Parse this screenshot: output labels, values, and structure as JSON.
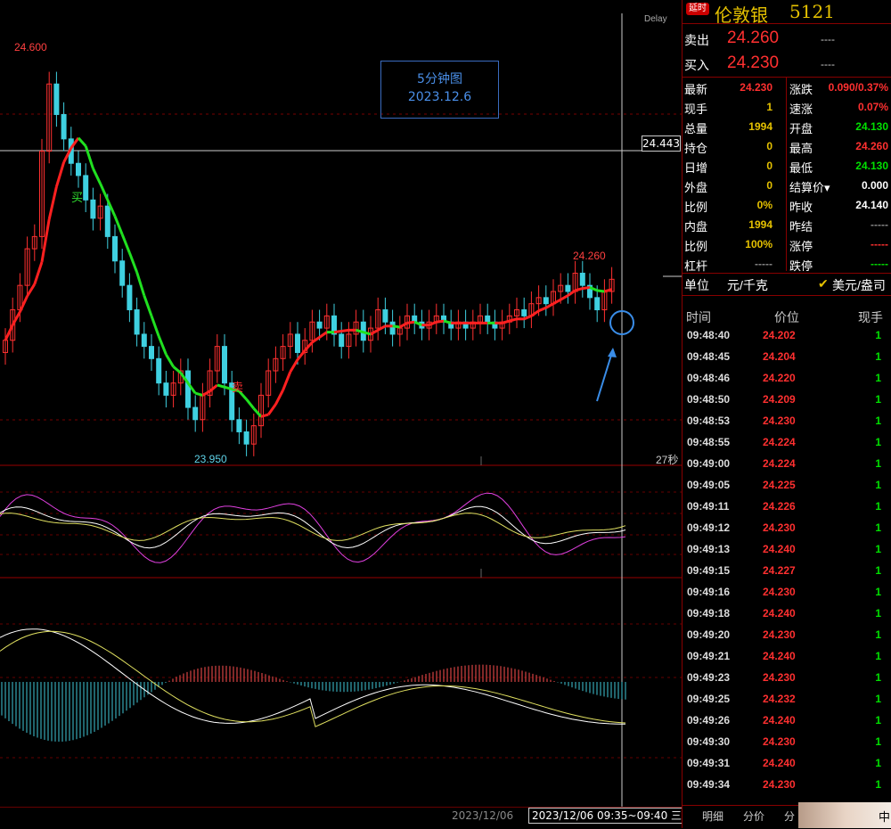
{
  "chart": {
    "delay_label": "Delay",
    "high_label": "24.600",
    "low_label": "23.950",
    "recent_high_label": "24.260",
    "crosshair_price": "24.443",
    "countdown": "27秒",
    "buy_marker": "买",
    "sell_marker": "卖",
    "annotation_line1": "5分钟图",
    "annotation_line2": "2023.12.6",
    "date_left": "2023/12/06",
    "date_range": "2023/12/06 09:35~09:40 三"
  },
  "chart_data": {
    "type": "candlestick",
    "price_range": [
      23.95,
      24.6
    ],
    "closes": [
      24.13,
      24.18,
      24.22,
      24.28,
      24.3,
      24.44,
      24.55,
      24.5,
      24.46,
      24.42,
      24.4,
      24.36,
      24.33,
      24.35,
      24.3,
      24.26,
      24.22,
      24.18,
      24.14,
      24.12,
      24.1,
      24.06,
      24.04,
      24.06,
      24.08,
      24.02,
      24.0,
      24.04,
      24.08,
      24.12,
      24.06,
      24.0,
      23.98,
      23.96,
      23.99,
      24.04,
      24.08,
      24.1,
      24.12,
      24.14,
      24.11,
      24.13,
      24.16,
      24.15,
      24.17,
      24.14,
      24.12,
      24.14,
      24.16,
      24.13,
      24.15,
      24.18,
      24.16,
      24.14,
      24.15,
      24.17,
      24.16,
      24.15,
      24.16,
      24.17,
      24.16,
      24.15,
      24.16,
      24.15,
      24.16,
      24.17,
      24.16,
      24.15,
      24.16,
      24.17,
      24.18,
      24.17,
      24.19,
      24.2,
      24.19,
      24.21,
      24.22,
      24.21,
      24.24,
      24.22,
      24.2,
      24.18,
      24.21,
      24.23
    ]
  },
  "quote": {
    "badge": "延时",
    "name": "伦敦银",
    "code": "5121",
    "sell_label": "卖出",
    "sell_price": "24.260",
    "sell_vol": "----",
    "buy_label": "买入",
    "buy_price": "24.230",
    "buy_vol": "----"
  },
  "stats": [
    {
      "l1": "最新",
      "v1": "24.230",
      "c1": "#ff3030",
      "l2": "涨跌",
      "v2": "0.090/0.37%",
      "c2": "#ff3030"
    },
    {
      "l1": "现手",
      "v1": "1",
      "c1": "#e5c100",
      "l2": "速涨",
      "v2": "0.07%",
      "c2": "#ff3030"
    },
    {
      "l1": "总量",
      "v1": "1994",
      "c1": "#e5c100",
      "l2": "开盘",
      "v2": "24.130",
      "c2": "#00e000"
    },
    {
      "l1": "持仓",
      "v1": "0",
      "c1": "#e5c100",
      "l2": "最高",
      "v2": "24.260",
      "c2": "#ff3030"
    },
    {
      "l1": "日增",
      "v1": "0",
      "c1": "#e5c100",
      "l2": "最低",
      "v2": "24.130",
      "c2": "#00e000"
    },
    {
      "l1": "外盘",
      "v1": "0",
      "c1": "#e5c100",
      "l2": "结算价▾",
      "v2": "0.000",
      "c2": "#ffffff"
    },
    {
      "l1": "比例",
      "v1": "0%",
      "c1": "#e5c100",
      "l2": "昨收",
      "v2": "24.140",
      "c2": "#ffffff"
    },
    {
      "l1": "内盘",
      "v1": "1994",
      "c1": "#e5c100",
      "l2": "昨结",
      "v2": "-----",
      "c2": "#888888"
    },
    {
      "l1": "比例",
      "v1": "100%",
      "c1": "#e5c100",
      "l2": "涨停",
      "v2": "-----",
      "c2": "#ff3030"
    },
    {
      "l1": "杠杆",
      "v1": "-----",
      "c1": "#888888",
      "l2": "跌停",
      "v2": "-----",
      "c2": "#00e000"
    }
  ],
  "unit": {
    "label": "单位",
    "value": "元/千克",
    "check": "✔",
    "alt": "美元/盎司"
  },
  "ticks_header": {
    "time": "时间",
    "price": "价位",
    "vol": "现手"
  },
  "ticks": [
    {
      "t": "09:48:40",
      "p": "24.202",
      "v": "1"
    },
    {
      "t": "09:48:45",
      "p": "24.204",
      "v": "1"
    },
    {
      "t": "09:48:46",
      "p": "24.220",
      "v": "1"
    },
    {
      "t": "09:48:50",
      "p": "24.209",
      "v": "1"
    },
    {
      "t": "09:48:53",
      "p": "24.230",
      "v": "1"
    },
    {
      "t": "09:48:55",
      "p": "24.224",
      "v": "1"
    },
    {
      "t": "09:49:00",
      "p": "24.224",
      "v": "1"
    },
    {
      "t": "09:49:05",
      "p": "24.225",
      "v": "1"
    },
    {
      "t": "09:49:11",
      "p": "24.226",
      "v": "1"
    },
    {
      "t": "09:49:12",
      "p": "24.230",
      "v": "1"
    },
    {
      "t": "09:49:13",
      "p": "24.240",
      "v": "1"
    },
    {
      "t": "09:49:15",
      "p": "24.227",
      "v": "1"
    },
    {
      "t": "09:49:16",
      "p": "24.230",
      "v": "1"
    },
    {
      "t": "09:49:18",
      "p": "24.240",
      "v": "1"
    },
    {
      "t": "09:49:20",
      "p": "24.230",
      "v": "1"
    },
    {
      "t": "09:49:21",
      "p": "24.240",
      "v": "1"
    },
    {
      "t": "09:49:23",
      "p": "24.230",
      "v": "1"
    },
    {
      "t": "09:49:25",
      "p": "24.232",
      "v": "1"
    },
    {
      "t": "09:49:26",
      "p": "24.240",
      "v": "1"
    },
    {
      "t": "09:49:30",
      "p": "24.230",
      "v": "1"
    },
    {
      "t": "09:49:31",
      "p": "24.240",
      "v": "1"
    },
    {
      "t": "09:49:34",
      "p": "24.230",
      "v": "1"
    }
  ],
  "tabs": {
    "t1": "明细",
    "t2": "分价",
    "t3": "分",
    "thumb": "中"
  }
}
